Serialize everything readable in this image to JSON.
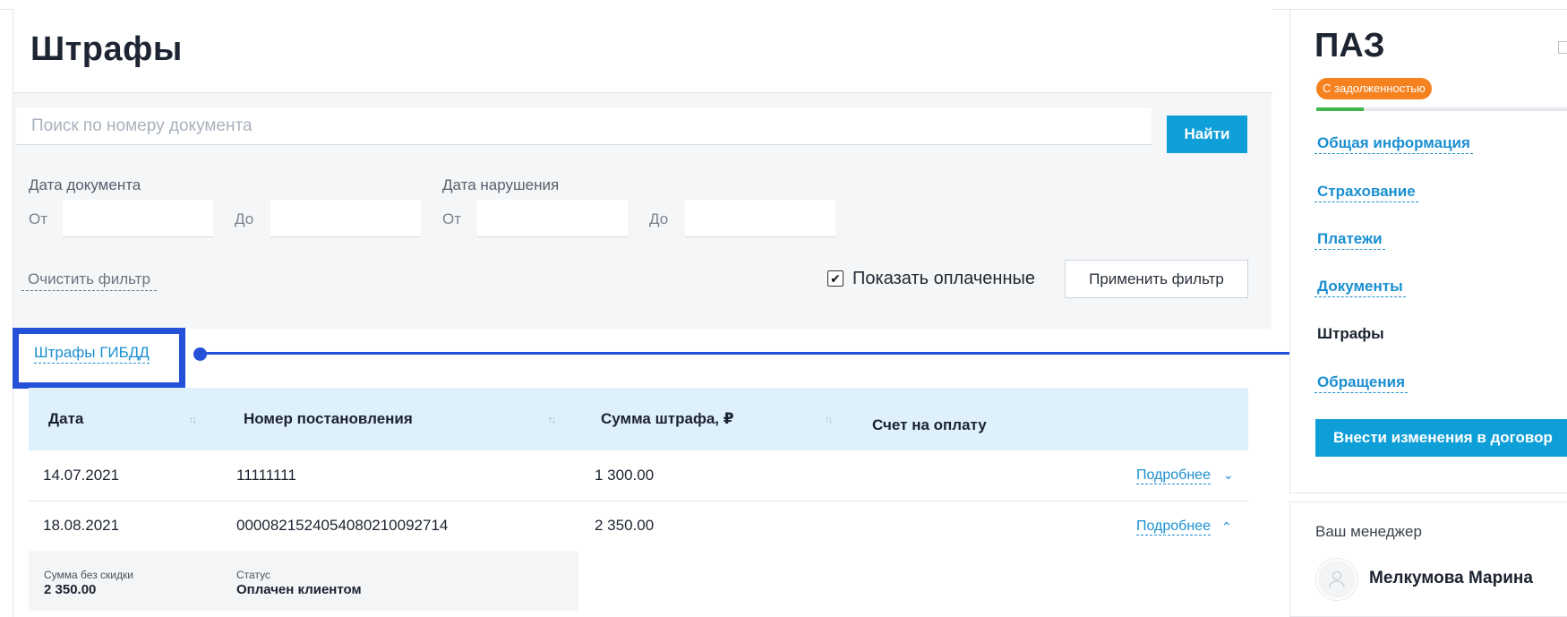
{
  "page": {
    "title": "Штрафы"
  },
  "search": {
    "placeholder": "Поиск по номеру документа",
    "button_label": "Найти"
  },
  "filters": {
    "doc_date_label": "Дата документа",
    "violation_date_label": "Дата нарушения",
    "from_label": "От",
    "to_label": "До",
    "clear_label": "Очистить фильтр",
    "show_paid_label": "Показать оплаченные",
    "show_paid_checked": true,
    "apply_label": "Применить фильтр"
  },
  "section": {
    "tab_label": "Штрафы ГИБДД"
  },
  "table": {
    "headers": [
      "Дата",
      "Номер постановления",
      "Сумма штрафа, ₽",
      "Счет на оплату"
    ],
    "rows": [
      {
        "date": "14.07.2021",
        "number": "11111111",
        "amount": "1 300.00",
        "details": "Подробнее",
        "expanded": false
      },
      {
        "date": "18.08.2021",
        "number": "0000821524054080210092714",
        "amount": "2 350.00",
        "details": "Подробнее",
        "expanded": true
      }
    ],
    "expanded": {
      "amount_label": "Сумма без скидки",
      "amount_value": "2 350.00",
      "status_label": "Статус",
      "status_value": "Оплачен клиентом"
    }
  },
  "sidebar": {
    "title": "ПАЗ",
    "badge": "С задолженностью",
    "progress": 0.19,
    "links": [
      "Общая информация",
      "Страхование",
      "Платежи",
      "Документы",
      "Штрафы",
      "Обращения"
    ],
    "active_link": "Штрафы",
    "change_button": "Внести изменения в договор",
    "manager_label": "Ваш менеджер",
    "manager_name": "Мелкумова Марина"
  },
  "colors": {
    "accent": "#0f9fd8",
    "link": "#1a8fd1",
    "badge": "#f5821f",
    "progress": "#3db54a",
    "highlight": "#2550d8",
    "table_header_bg": "#def0fb"
  }
}
